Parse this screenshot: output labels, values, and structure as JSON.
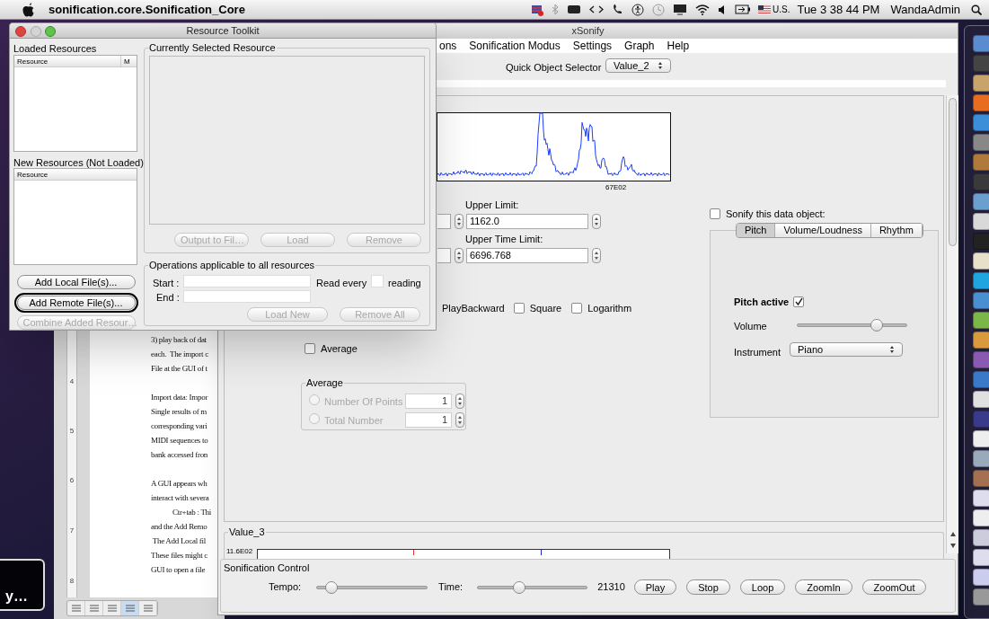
{
  "menu_bar": {
    "app_name": "sonification.core.Sonification_Core",
    "input_source": "U.S.",
    "clock": "Tue 3 38 44 PM",
    "user": "WandaAdmin"
  },
  "document": {
    "ruler_marks": [
      "4",
      "5",
      "6",
      "7",
      "8"
    ],
    "lines": [
      {
        "kind": "text",
        "text": "3) play back of dat"
      },
      {
        "kind": "text",
        "text": "each.  The import c"
      },
      {
        "kind": "text",
        "text": "File at the GUI of t"
      },
      {
        "kind": "blank"
      },
      {
        "kind": "text",
        "text": "Import data: Impor"
      },
      {
        "kind": "text",
        "text": "Single results of m"
      },
      {
        "kind": "text",
        "text": "corresponding vari"
      },
      {
        "kind": "text",
        "text": "MIDI sequences to"
      },
      {
        "kind": "text",
        "text": "bank accessed fron"
      },
      {
        "kind": "blank"
      },
      {
        "kind": "text",
        "text": "A GUI appears wh"
      },
      {
        "kind": "text",
        "text": "interact with severa"
      },
      {
        "kind": "text",
        "text": "Ctr+tab : Thi",
        "indent": true
      },
      {
        "kind": "text",
        "text": "and the Add Remo"
      },
      {
        "kind": "text",
        "text": " The Add Local fil"
      },
      {
        "kind": "text",
        "text": "These files might c"
      },
      {
        "kind": "text",
        "text": "GUI to open a file"
      }
    ],
    "view_buttons": [
      {
        "selected": false
      },
      {
        "selected": false
      },
      {
        "selected": false
      },
      {
        "selected": true
      },
      {
        "selected": false
      }
    ]
  },
  "partial_window": {
    "text": "y…"
  },
  "xsonify": {
    "title": "xSonify",
    "menus": [
      "ons",
      "Sonification Modus",
      "Settings",
      "Graph",
      "Help"
    ],
    "quick_selector": {
      "label": "Quick Object Selector",
      "value": "Value_2"
    },
    "graph": {
      "axis_label": "67E02"
    },
    "upper_limit": {
      "label": "Upper Limit:",
      "value": "1162.0"
    },
    "upper_time_limit": {
      "label": "Upper Time Limit:",
      "value": "6696.768"
    },
    "play_backward_label": "PlayBackward",
    "options": [
      {
        "label": "Square",
        "checked": false
      },
      {
        "label": "Logarithm",
        "checked": false
      }
    ],
    "average_checkbox": {
      "label": "Average",
      "checked": false
    },
    "average_group": {
      "title": "Average",
      "disabled": true,
      "choices": [
        {
          "label": "Number Of Points",
          "selected": false,
          "value": "1"
        },
        {
          "label": "Total Number",
          "selected": false,
          "value": "1"
        }
      ]
    },
    "sonify": {
      "label": "Sonify this data object:",
      "checked": false,
      "tabs": [
        {
          "label": "Pitch",
          "selected": true
        },
        {
          "label": "Volume/Loudness",
          "selected": false
        },
        {
          "label": "Rhythm",
          "selected": false
        }
      ],
      "pitch_active": {
        "label": "Pitch active",
        "checked": true
      },
      "volume": {
        "label": "Volume",
        "level": 0.72
      },
      "instrument": {
        "label": "Instrument",
        "value": "Piano"
      }
    },
    "value_plot": {
      "title": "Value_3",
      "axis_label": "11.6E02"
    },
    "sonification_control": {
      "title": "Sonification Control",
      "tempo": {
        "label": "Tempo:",
        "level": 0.14
      },
      "time": {
        "label": "Time:",
        "level": 0.38,
        "reading": "21310"
      },
      "buttons": [
        "Play",
        "Stop",
        "Loop",
        "ZoomIn",
        "ZoomOut"
      ]
    }
  },
  "resource_toolkit": {
    "title": "Resource Toolkit",
    "loaded": {
      "title": "Loaded Resources",
      "columns": [
        "Resource",
        "M"
      ]
    },
    "new": {
      "title": "New Resources (Not Loaded)",
      "columns": [
        "Resource"
      ]
    },
    "side_buttons": [
      {
        "label": "Add Local File(s)...",
        "disabled": false,
        "focused": false
      },
      {
        "label": "Add Remote File(s)...",
        "disabled": false,
        "focused": true
      },
      {
        "label": "Combine Added Resour…",
        "disabled": true,
        "focused": false
      }
    ],
    "selected_group": {
      "title": "Currently Selected Resource",
      "buttons": [
        {
          "label": "Output to Fil…",
          "disabled": true
        },
        {
          "label": "Load",
          "disabled": true
        },
        {
          "label": "Remove",
          "disabled": true
        }
      ]
    },
    "operations": {
      "title": "Operations applicable to all resources",
      "start_label": "Start :",
      "end_label": "End :",
      "read_every_label": "Read every",
      "reading_label": "reading",
      "buttons": [
        {
          "label": "Load New",
          "disabled": true
        },
        {
          "label": "Remove All",
          "disabled": true
        }
      ]
    }
  }
}
